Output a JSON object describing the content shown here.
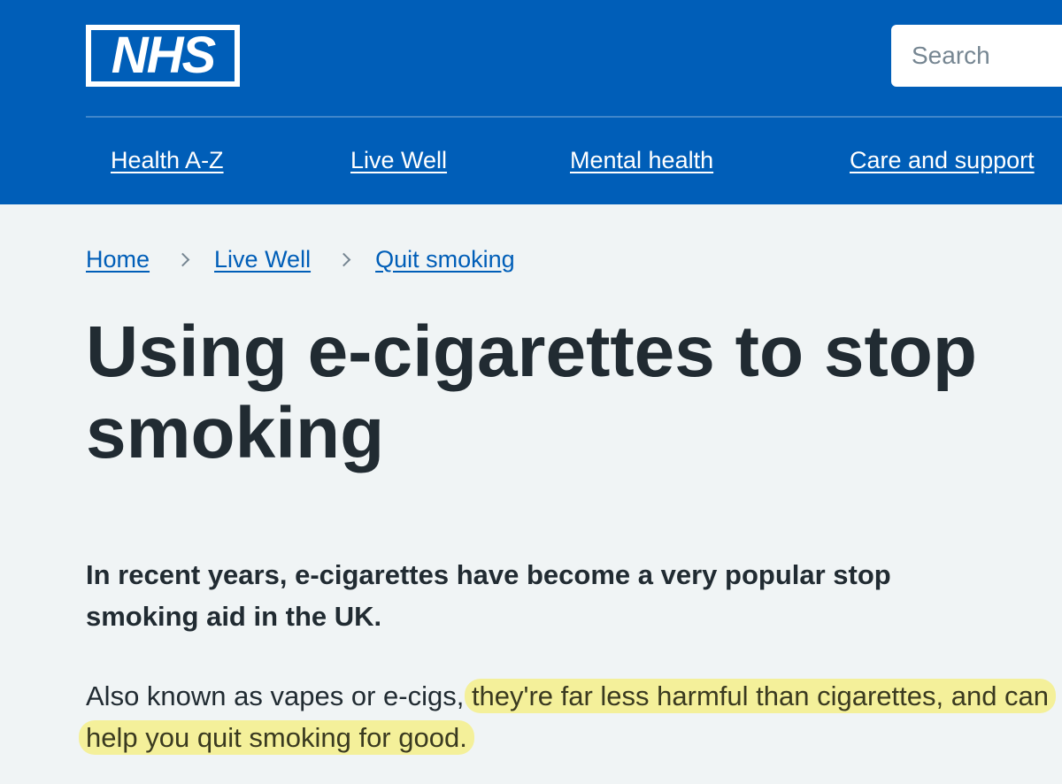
{
  "header": {
    "logo_text": "NHS",
    "search_placeholder": "Search",
    "brand_color": "#005eb8"
  },
  "nav": {
    "items": [
      {
        "label": "Health A-Z"
      },
      {
        "label": "Live Well"
      },
      {
        "label": "Mental health"
      },
      {
        "label": "Care and support"
      }
    ]
  },
  "breadcrumb": {
    "items": [
      {
        "label": "Home"
      },
      {
        "label": "Live Well"
      },
      {
        "label": "Quit smoking"
      }
    ],
    "separator_icon": "chevron-right-icon"
  },
  "page": {
    "title": "Using e-cigarettes to stop smoking",
    "lede": "In recent years, e-cigarettes have become a very popular stop smoking aid in the UK.",
    "body_intro": "Also known as vapes or e-cigs, ",
    "body_highlighted": "they're far less harmful than cigarettes, and can help you quit smoking for good.",
    "highlight_color": "#f4f09a"
  }
}
